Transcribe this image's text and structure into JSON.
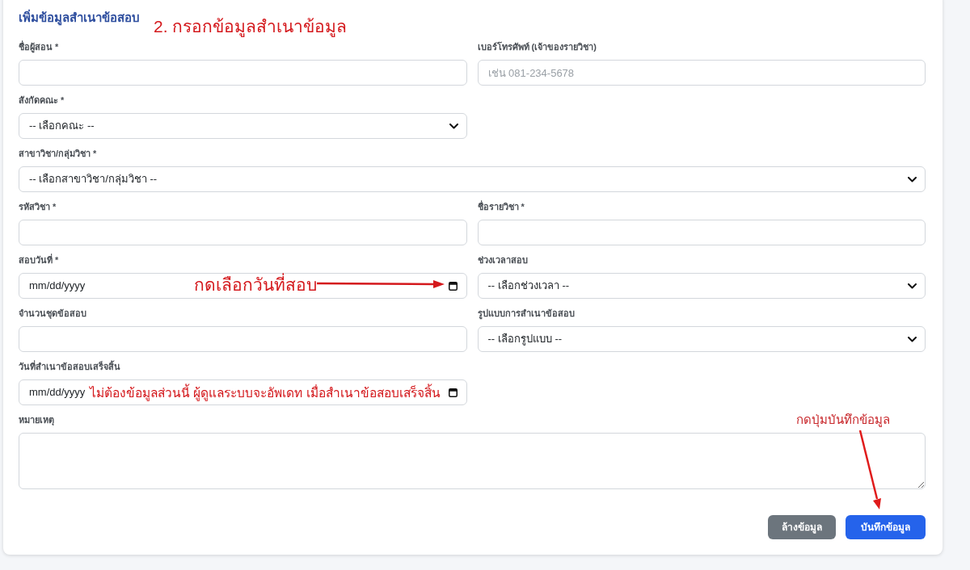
{
  "form": {
    "title": "เพิ่มข้อมูลสำเนาข้อสอบ",
    "fields": [
      {
        "kind": "text",
        "label": "ชื่อผู้สอน *",
        "full_width": false
      },
      {
        "kind": "text",
        "label": "เบอร์โทรศัพท์ (เจ้าของรายวิชา)",
        "placeholder": "เช่น 081-234-5678",
        "full_width": false
      },
      {
        "kind": "select",
        "label": "สังกัดคณะ *",
        "value": "-- เลือกคณะ --",
        "full_width": false
      },
      {
        "kind": "select",
        "label": "สาขาวิชา/กลุ่มวิชา *",
        "value": "-- เลือกสาขาวิชา/กลุ่มวิชา --",
        "full_width": true
      },
      {
        "kind": "text",
        "label": "รหัสวิชา *",
        "full_width": false
      },
      {
        "kind": "text",
        "label": "ชื่อรายวิชา *",
        "full_width": false
      },
      {
        "kind": "date",
        "label": "สอบวันที่ *",
        "placeholder": "mm/dd/yyyy",
        "full_width": false
      },
      {
        "kind": "select",
        "label": "ช่วงเวลาสอบ",
        "value": "-- เลือกช่วงเวลา --",
        "full_width": false
      },
      {
        "kind": "text",
        "label": "จำนวนชุดข้อสอบ",
        "full_width": false
      },
      {
        "kind": "select",
        "label": "รูปแบบการสำเนาข้อสอบ",
        "value": "-- เลือกรูปแบบ --",
        "full_width": false
      },
      {
        "kind": "date",
        "label": "วันที่สำเนาข้อสอบเสร็จสิ้น",
        "placeholder": "mm/dd/yyyy",
        "full_width": false
      },
      {
        "kind": "textarea",
        "label": "หมายเหตุ",
        "full_width": true
      }
    ],
    "buttons": [
      {
        "kind": "secondary",
        "label": "ล้างข้อมูล"
      },
      {
        "kind": "primary",
        "label": "บันทึกข้อมูล"
      }
    ]
  },
  "annotations": [
    {
      "text": "2. กรอกข้อมูลสำเนาข้อมูล",
      "arrow": false
    },
    {
      "text": "กดเลือกวันที่สอบ",
      "arrow": true
    },
    {
      "text": "ไม่ต้องข้อมูลส่วนนี้ ผู้ดูแลระบบจะอัพเดท เมื่อสำเนาข้อสอบเสร็จสิ้น",
      "arrow": false
    },
    {
      "text": "กดปุ่มบันทึกข้อมูล",
      "arrow": true
    }
  ]
}
